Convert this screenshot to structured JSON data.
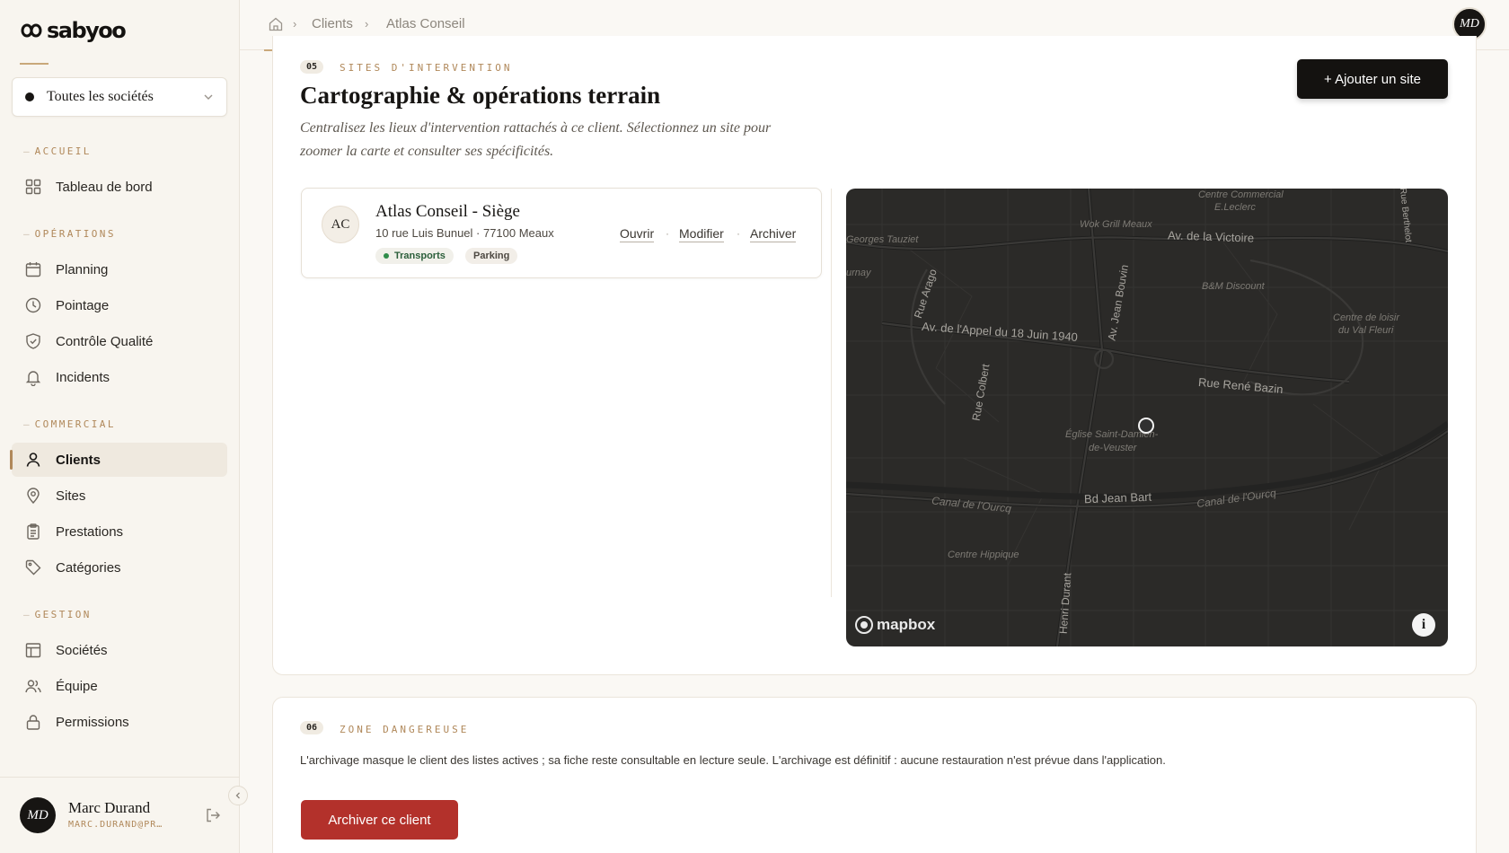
{
  "brand": {
    "name": "sabyoo"
  },
  "company_select": {
    "label": "Toutes les sociétés"
  },
  "nav": {
    "sections": {
      "accueil": "ACCUEIL",
      "operations": "OPÉRATIONS",
      "commercial": "COMMERCIAL",
      "gestion": "GESTION"
    },
    "items": {
      "dashboard": "Tableau de bord",
      "planning": "Planning",
      "pointage": "Pointage",
      "qualite": "Contrôle Qualité",
      "incidents": "Incidents",
      "clients": "Clients",
      "sites": "Sites",
      "prestations": "Prestations",
      "categories": "Catégories",
      "societes": "Sociétés",
      "equipe": "Équipe",
      "permissions": "Permissions"
    },
    "active": "clients"
  },
  "user": {
    "initials": "MD",
    "name": "Marc Durand",
    "email": "MARC.DURAND@PR…"
  },
  "breadcrumb": {
    "items": [
      "Clients",
      "Atlas Conseil"
    ]
  },
  "sites_section": {
    "number": "05",
    "label": "SITES D'INTERVENTION",
    "title": "Cartographie & opérations terrain",
    "description": "Centralisez les lieux d'intervention rattachés à ce client. Sélectionnez un site pour zoomer la carte et consulter ses spécificités.",
    "add_button": "+ Ajouter un site"
  },
  "site": {
    "initials": "AC",
    "name": "Atlas Conseil - Siège",
    "address": "10 rue Luis Bunuel · 77100 Meaux",
    "tags": [
      "Transports",
      "Parking"
    ],
    "actions": {
      "open": "Ouvrir",
      "edit": "Modifier",
      "archive": "Archiver"
    },
    "separator": "·"
  },
  "map": {
    "attribution": "mapbox",
    "labels": {
      "centre_commercial": "Centre Commercial",
      "leclerc": "E.Leclerc",
      "wok": "Wok Grill Meaux",
      "victoire": "Av. de la Victoire",
      "tauziet": "Georges Tauziet",
      "urnay": "urnay",
      "arago": "Rue Arago",
      "bouvin": "Av. Jean Bouvin",
      "bm": "B&M Discount",
      "loisir1": "Centre de loisir",
      "loisir2": "du Val Fleuri",
      "appel": "Av. de l'Appel du 18 Juin 1940",
      "colbert": "Rue Colbert",
      "bazin": "Rue René Bazin",
      "eglise1": "Église Saint-Damien-",
      "eglise2": "de-Veuster",
      "canal_left": "Canal de l'Ourcq",
      "jean_bart": "Bd Jean Bart",
      "canal_right": "Canal de l'Ourcq",
      "hippique": "Centre Hippique",
      "durant": "Henri Durant",
      "berthelot": "Rue Berthelot"
    }
  },
  "danger_section": {
    "number": "06",
    "label": "ZONE DANGEREUSE",
    "text": "L'archivage masque le client des listes actives ; sa fiche reste consultable en lecture seule. L'archivage est définitif : aucune restauration n'est prévue dans l'application.",
    "button": "Archiver ce client"
  }
}
